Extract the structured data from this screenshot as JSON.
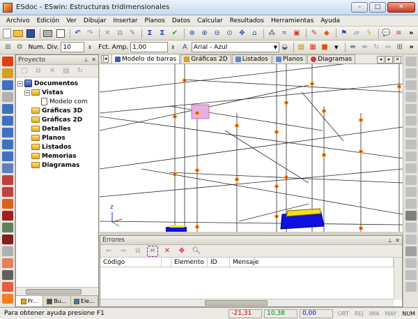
{
  "window": {
    "title": "ESdoc - ESwin: Estructuras tridimensionales",
    "buttons": [
      "–",
      "□",
      "✕"
    ]
  },
  "menu": [
    "Archivo",
    "Edición",
    "Ver",
    "Dibujar",
    "Insertar",
    "Planos",
    "Datos",
    "Calcular",
    "Resultados",
    "Herramientas",
    "Ayuda"
  ],
  "toolbar2": {
    "num_div_label": "Num. Div.",
    "num_div_value": "10",
    "fct_amp_label": "Fct. Amp.",
    "fct_amp_value": "1,00",
    "font_value": "Arial - Azul"
  },
  "project": {
    "title": "Proyecto",
    "tree": [
      {
        "label": "Documentos",
        "level": 0,
        "icon": "database-icon",
        "bold": true,
        "expander": "−"
      },
      {
        "label": "Vistas",
        "level": 1,
        "icon": "folder-open-icon",
        "bold": true,
        "expander": "−"
      },
      {
        "label": "Modelo com",
        "level": 2,
        "icon": "document-icon",
        "bold": false,
        "expander": ""
      },
      {
        "label": "Gráficas 3D",
        "level": 1,
        "icon": "folder-icon",
        "bold": true,
        "expander": ""
      },
      {
        "label": "Gráficas 2D",
        "level": 1,
        "icon": "folder-icon",
        "bold": true,
        "expander": ""
      },
      {
        "label": "Detalles",
        "level": 1,
        "icon": "folder-icon",
        "bold": true,
        "expander": ""
      },
      {
        "label": "Planos",
        "level": 1,
        "icon": "folder-icon",
        "bold": true,
        "expander": ""
      },
      {
        "label": "Listados",
        "level": 1,
        "icon": "folder-icon",
        "bold": true,
        "expander": ""
      },
      {
        "label": "Memorias",
        "level": 1,
        "icon": "folder-icon",
        "bold": true,
        "expander": ""
      },
      {
        "label": "Diagramas",
        "level": 1,
        "icon": "folder-icon",
        "bold": true,
        "expander": ""
      }
    ],
    "bottom_tabs": [
      "Pr...",
      "Bu...",
      "Ele..."
    ]
  },
  "doc_tabs": [
    {
      "label": "Modelo de barras",
      "active": true,
      "color": "#3a5fb0"
    },
    {
      "label": "Gráficas 2D",
      "active": false,
      "color": "#d8a020"
    },
    {
      "label": "Listados",
      "active": false,
      "color": "#5a8ad0"
    },
    {
      "label": "Planos",
      "active": false,
      "color": "#5a8ad0"
    },
    {
      "label": "Diagramas",
      "active": false,
      "color": "#c84040"
    }
  ],
  "canvas": {
    "axis_label": "z"
  },
  "errors": {
    "title": "Errores",
    "columns": [
      "Código",
      "Elemento",
      "ID",
      "Mensaje"
    ]
  },
  "status": {
    "help": "Para obtener ayuda presione F1",
    "x": "-21,31",
    "y": "10,38",
    "z": "0,00",
    "indicators": [
      "ORT",
      "REJ",
      "IMA",
      "MAY",
      "NUM"
    ],
    "x_color": "#c00000",
    "y_color": "#008000",
    "z_color": "#0000c0"
  }
}
